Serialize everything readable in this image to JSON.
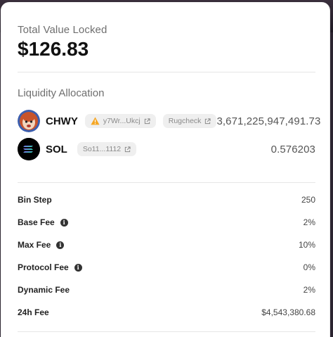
{
  "tvl": {
    "label": "Total Value Locked",
    "value": "$126.83"
  },
  "liquidity": {
    "label": "Liquidity Allocation",
    "tokens": [
      {
        "symbol": "CHWY",
        "address": "y7Wr...Ukcj",
        "address_warning_icon": "warning-icon",
        "extra_link": "Rugcheck",
        "amount": "3,671,225,947,491.73",
        "icon": "chwy-avatar-icon"
      },
      {
        "symbol": "SOL",
        "address": "So11...1112",
        "amount": "0.576203",
        "icon": "sol-logo-icon"
      }
    ]
  },
  "fees": [
    {
      "label": "Bin Step",
      "value": "250",
      "has_info": false
    },
    {
      "label": "Base Fee",
      "value": "2%",
      "has_info": true
    },
    {
      "label": "Max Fee",
      "value": "10%",
      "has_info": true
    },
    {
      "label": "Protocol Fee",
      "value": "0%",
      "has_info": true
    },
    {
      "label": "Dynamic Fee",
      "value": "2%",
      "has_info": false
    },
    {
      "label": "24h Fee",
      "value": "$4,543,380.68",
      "has_info": false
    }
  ],
  "info_icon_glyph": "i",
  "colors": {
    "card_bg": "#ffffff",
    "page_bg": "#2b2430",
    "warning": "#f5a623"
  }
}
